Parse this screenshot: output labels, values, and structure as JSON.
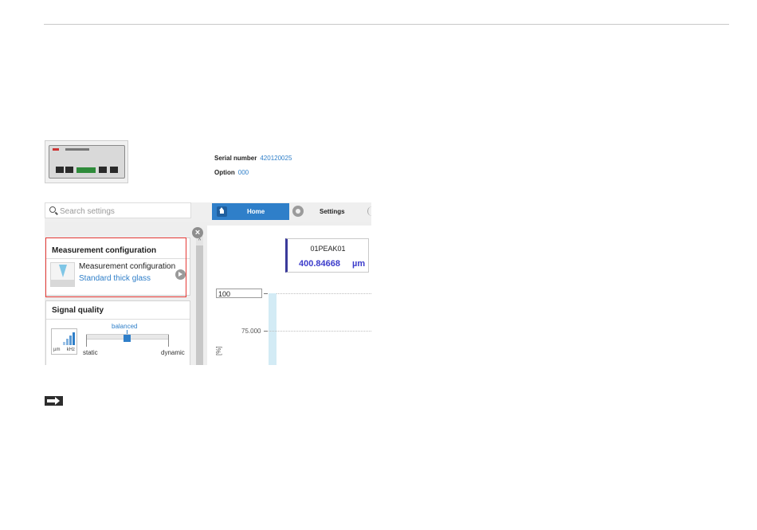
{
  "device": {
    "serial_label": "Serial number",
    "serial_value": "420120025",
    "option_label": "Option",
    "option_value": "000"
  },
  "search": {
    "placeholder": "Search settings"
  },
  "tabs": {
    "home": "Home",
    "settings": "Settings"
  },
  "measurement_card": {
    "title": "Measurement configuration",
    "item_label": "Measurement configuration",
    "item_value": "Standard thick glass"
  },
  "signal_card": {
    "title": "Signal quality",
    "level": "balanced",
    "left_label": "static",
    "right_label": "dynamic",
    "icon_left_unit": "µm",
    "icon_right_unit": "kHz"
  },
  "value_box": {
    "name": "01PEAK01",
    "value": "400.84668",
    "unit": "µm"
  },
  "chart": {
    "ymax_input": "100",
    "tick_75": "75.000",
    "y_unit": "[%]"
  },
  "colors": {
    "accent": "#2f7fc9",
    "highlight_frame": "#e53935",
    "value_text": "#3c3ccb"
  }
}
